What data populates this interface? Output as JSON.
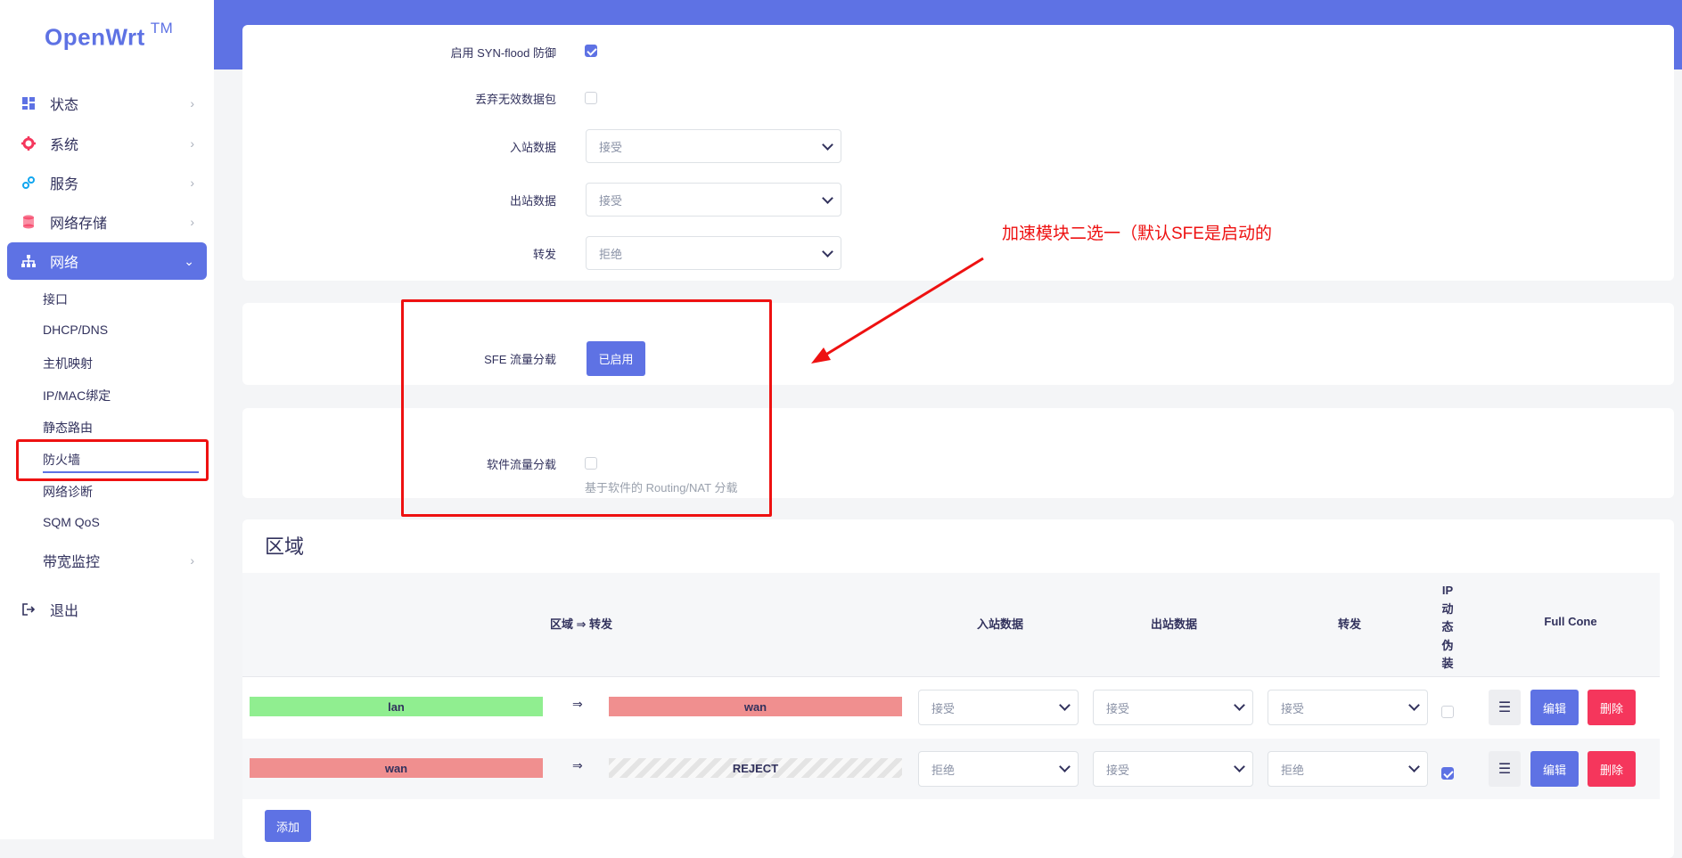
{
  "brand": {
    "name": "OpenWrt",
    "tm": "TM"
  },
  "sidebar": {
    "menu": [
      {
        "label": "状态",
        "icon": "dashboard-icon"
      },
      {
        "label": "系统",
        "icon": "gear-icon"
      },
      {
        "label": "服务",
        "icon": "services-icon"
      },
      {
        "label": "网络存储",
        "icon": "database-icon"
      },
      {
        "label": "网络",
        "icon": "network-icon"
      }
    ],
    "network_sub": [
      "接口",
      "DHCP/DNS",
      "主机映射",
      "IP/MAC绑定",
      "静态路由",
      "防火墙",
      "网络诊断",
      "SQM QoS"
    ],
    "bandwidth": "带宽监控",
    "logout": "退出"
  },
  "general": {
    "syn_flood_label": "启用 SYN-flood 防御",
    "syn_flood_checked": true,
    "drop_invalid_label": "丢弃无效数据包",
    "drop_invalid_checked": false,
    "input_label": "入站数据",
    "input_value": "接受",
    "output_label": "出站数据",
    "output_value": "接受",
    "forward_label": "转发",
    "forward_value": "拒绝"
  },
  "offload": {
    "sfe_label": "SFE 流量分载",
    "sfe_button": "已启用",
    "software_label": "软件流量分载",
    "software_checked": false,
    "software_hint": "基于软件的 Routing/NAT 分载"
  },
  "annotation": "加速模块二选一（默认SFE是启动的",
  "zones": {
    "title": "区域",
    "headers": {
      "zone_forward": "区域 ⇒ 转发",
      "input": "入站数据",
      "output": "出站数据",
      "forward": "转发",
      "masq": [
        "IP",
        "动",
        "态",
        "伪",
        "装"
      ],
      "fullcone": "Full Cone"
    },
    "arrow": "⇒",
    "rows": [
      {
        "zone": "lan",
        "dest": "wan",
        "input": "接受",
        "output": "接受",
        "forward": "接受",
        "masq": false,
        "edit": "编辑",
        "delete": "删除",
        "menu": "☰"
      },
      {
        "zone": "wan",
        "dest": "REJECT",
        "input": "拒绝",
        "output": "接受",
        "forward": "拒绝",
        "masq": true,
        "edit": "编辑",
        "delete": "删除",
        "menu": "☰"
      }
    ],
    "add_button": "添加"
  },
  "colors": {
    "accent": "#5e72e4",
    "danger": "#f5365c",
    "lan_zone": "#90ee90",
    "wan_zone": "#f08f8f",
    "annotation": "#ee1111"
  }
}
